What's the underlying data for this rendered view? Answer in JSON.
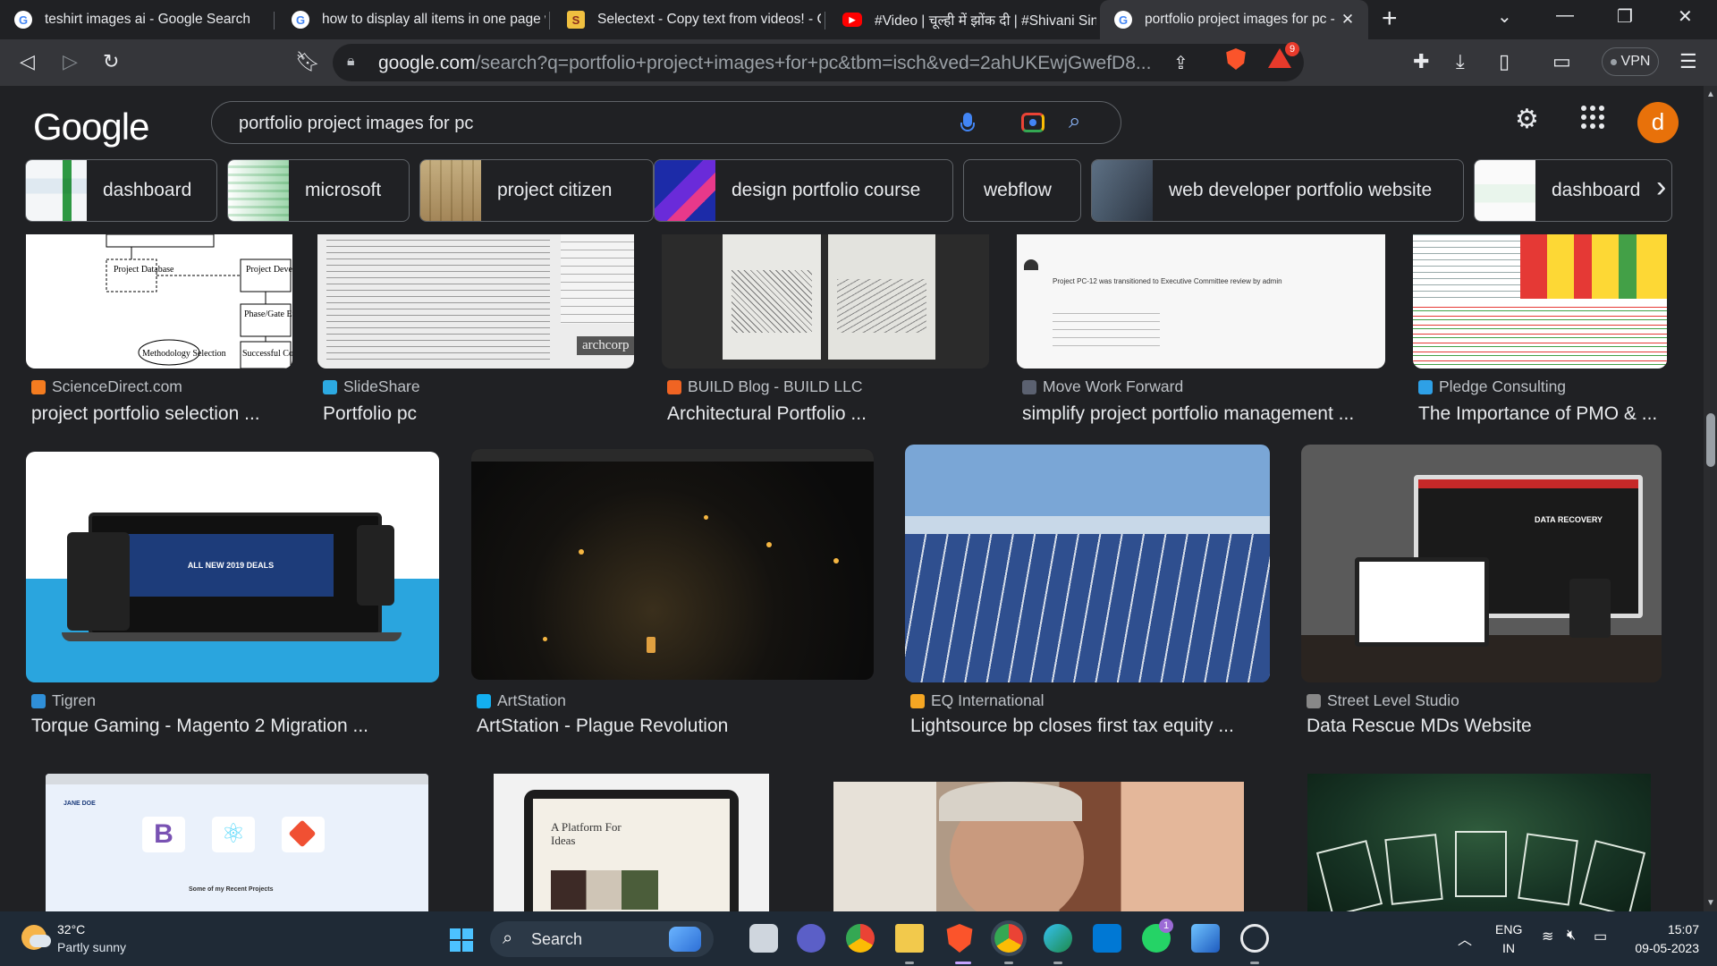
{
  "browser": {
    "tabs": [
      {
        "title": "teshirt images ai - Google Search",
        "favicon": "google-icon",
        "active": false
      },
      {
        "title": "how to display all items in one page w",
        "favicon": "google-icon",
        "active": false
      },
      {
        "title": "Selectext - Copy text from videos! - Ch",
        "favicon": "selectext-icon",
        "active": false
      },
      {
        "title": "#Video | चूल्ही में झोंक दी | #Shivani Sing",
        "favicon": "youtube-icon",
        "active": false
      },
      {
        "title": "portfolio project images for pc - ",
        "favicon": "google-icon",
        "active": true
      }
    ],
    "url_host": "google.com",
    "url_path": "/search?q=portfolio+project+images+for+pc&tbm=isch&ved=2ahUKEwjGwefD8...",
    "shields_badge": "9",
    "vpn_label": "VPN"
  },
  "google": {
    "logo_text": "Google",
    "query": "portfolio project images for pc",
    "avatar_letter": "d",
    "chips": [
      {
        "label": "dashboard",
        "has_thumb": true
      },
      {
        "label": "microsoft",
        "has_thumb": true
      },
      {
        "label": "project citizen",
        "has_thumb": true
      },
      {
        "label": "design portfolio course",
        "has_thumb": true
      },
      {
        "label": "webflow",
        "has_thumb": false
      },
      {
        "label": "web developer portfolio website",
        "has_thumb": true
      },
      {
        "label": "dashboard",
        "has_thumb": true
      }
    ]
  },
  "results": {
    "row1": [
      {
        "source": "ScienceDirect.com",
        "title": "project portfolio selection ...",
        "favicon_color": "#f47c20"
      },
      {
        "source": "SlideShare",
        "title": "Portfolio pc",
        "favicon_color": "#2ca9e1"
      },
      {
        "source": "BUILD Blog - BUILD LLC",
        "title": "Architectural Portfolio ...",
        "favicon_color": "#f06423"
      },
      {
        "source": "Move Work Forward",
        "title": "simplify project portfolio management ...",
        "favicon_color": "#5b6170"
      },
      {
        "source": "Pledge Consulting",
        "title": "The Importance of PMO & ...",
        "favicon_color": "#2ea0e6"
      }
    ],
    "row2": [
      {
        "source": "Tigren",
        "title": "Torque Gaming - Magento 2 Migration ...",
        "favicon_color": "#2f8fd8"
      },
      {
        "source": "ArtStation",
        "title": "ArtStation - Plague Revolution",
        "favicon_color": "#13aff0"
      },
      {
        "source": "EQ International",
        "title": "Lightsource bp closes first tax equity ...",
        "favicon_color": "#f5a623"
      },
      {
        "source": "Street Level Studio",
        "title": "Data Rescue MDs Website",
        "favicon_color": "#888888"
      }
    ],
    "row3_partial_text": {
      "name_text": "JANE DOE",
      "section_text": "Some of my Recent Projects",
      "tagline": "A Platform For Ideas",
      "tile_logo": "B"
    },
    "thumb_texts": {
      "diagram_boxes": [
        "Project Database",
        "Project Development",
        "Phase/Gate Evaluation",
        "Methodology Selection",
        "Successful Completion"
      ],
      "archcorp_mark": "archcorp",
      "notification_text": "Project PC-12 was transitioned to Executive Committee review by admin",
      "banner_text": "ALL NEW 2019 DEALS",
      "recovery_text": "DATA RECOVERY"
    }
  },
  "taskbar": {
    "temperature": "32°C",
    "weather": "Partly sunny",
    "search_label": "Search",
    "language": "ENG",
    "region": "IN",
    "time": "15:07",
    "date": "09-05-2023",
    "whatsapp_badge": "1"
  }
}
